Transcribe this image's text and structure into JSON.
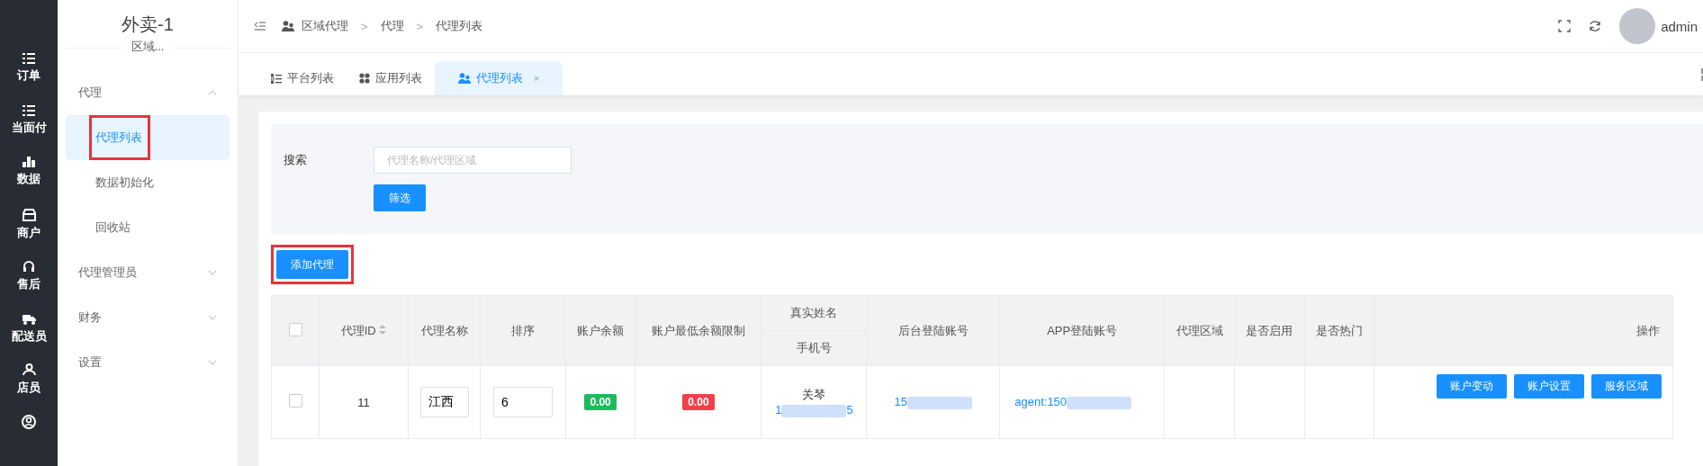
{
  "nav": [
    {
      "label": "订单"
    },
    {
      "label": "当面付"
    },
    {
      "label": "数据"
    },
    {
      "label": "商户"
    },
    {
      "label": "售后"
    },
    {
      "label": "配送员"
    },
    {
      "label": "店员"
    }
  ],
  "sidebar": {
    "title": "外卖-1",
    "subtitle": "区域...",
    "groups": [
      {
        "label": "代理",
        "expanded": true,
        "items": [
          {
            "label": "代理列表",
            "selected": true,
            "highlighted": true
          },
          {
            "label": "数据初始化",
            "selected": false,
            "highlighted": false
          },
          {
            "label": "回收站",
            "selected": false,
            "highlighted": false
          }
        ]
      },
      {
        "label": "代理管理员",
        "expanded": false
      },
      {
        "label": "财务",
        "expanded": false
      },
      {
        "label": "设置",
        "expanded": false
      }
    ]
  },
  "breadcrumb": {
    "items": [
      "区域代理",
      "代理",
      "代理列表"
    ],
    "separator": ">"
  },
  "user": {
    "name": "admin"
  },
  "tabs": [
    {
      "label": "平台列表",
      "selected": false
    },
    {
      "label": "应用列表",
      "selected": false
    },
    {
      "label": "代理列表",
      "selected": true,
      "close": "×"
    }
  ],
  "search": {
    "label": "搜索",
    "placeholder": "代理名称/代理区域",
    "button": "筛选"
  },
  "add_button": {
    "label": "添加代理",
    "highlighted": true
  },
  "table": {
    "all_checked": false,
    "columns": [
      "代理ID",
      "代理名称",
      "排序",
      "账户余额",
      "账户最低余额限制",
      "真实姓名",
      "手机号",
      "后台登陆账号",
      "APP登陆账号",
      "代理区域",
      "是否启用",
      "是否热门",
      "操作"
    ],
    "rows": [
      {
        "checked": false,
        "id": "11",
        "name": "江西",
        "sort": "6",
        "balance": "0.00",
        "min_balance": "0.00",
        "real_name": "关琴",
        "phone_start": "1",
        "phone_end": "5",
        "backend_account": "15",
        "app_account": "agent:150",
        "actions": [
          "账户变动",
          "账户设置",
          "服务区域"
        ]
      }
    ]
  }
}
